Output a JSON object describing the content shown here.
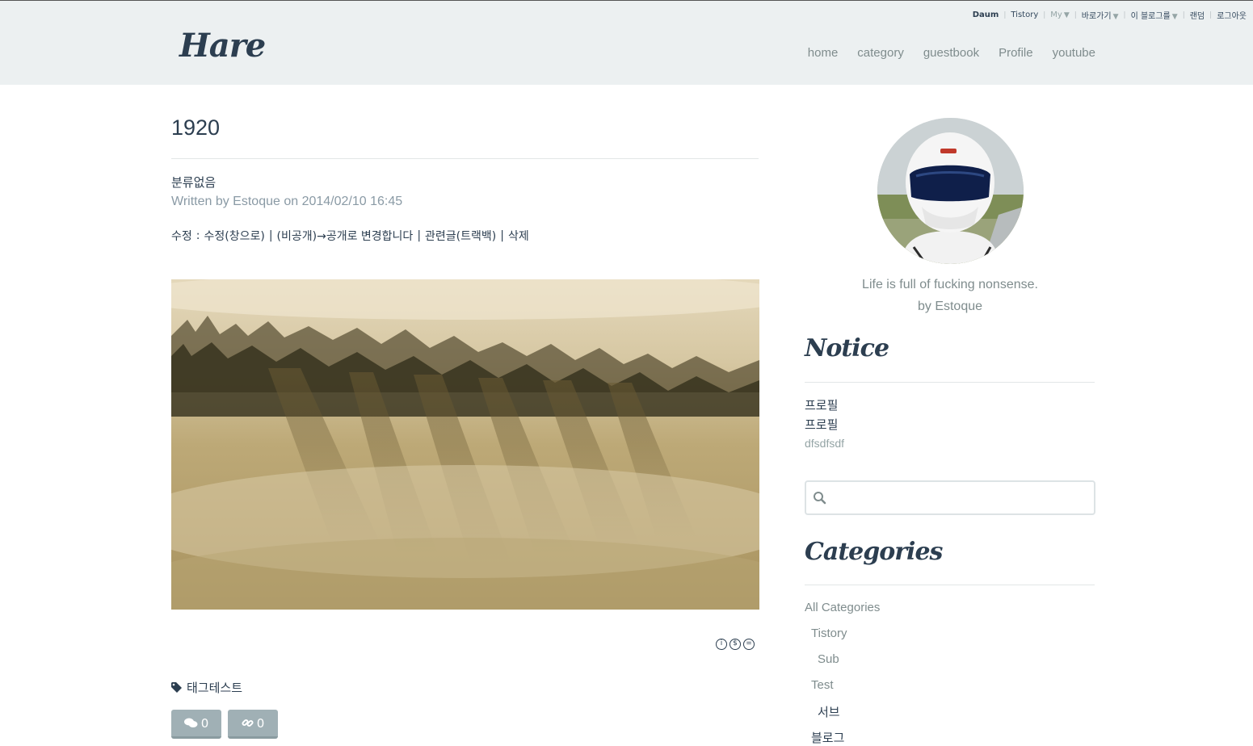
{
  "topbar": {
    "items": [
      {
        "label": "Daum",
        "dropdown": false
      },
      {
        "label": "Tistory",
        "dropdown": false
      },
      {
        "label": "My",
        "dropdown": true
      },
      {
        "label": "바로가기",
        "dropdown": true
      },
      {
        "label": "이 블로그를",
        "dropdown": true
      },
      {
        "label": "랜덤",
        "dropdown": false
      },
      {
        "label": "로그아웃",
        "dropdown": false
      }
    ],
    "arrow": "▼"
  },
  "header": {
    "logo": "Hare",
    "nav": [
      "home",
      "category",
      "guestbook",
      "Profile",
      "youtube"
    ]
  },
  "post": {
    "title": "1920",
    "category": "분류없음",
    "meta": "Written by Estoque on 2014/02/10 16:45",
    "admin": {
      "edit_label": "수정",
      "colon": ":",
      "edit_window": "수정(창으로)",
      "visibility": "(비공개)→공개로 변경합니다",
      "trackback": "관련글(트랙백)",
      "delete": "삭제",
      "sep": "|"
    },
    "tag": "태그테스트",
    "comment_count": "0",
    "trackback_count": "0"
  },
  "sidebar": {
    "tagline_line1": "Life is full of fucking nonsense.",
    "tagline_line2": "by Estoque",
    "notice_title": "Notice",
    "notices": [
      "프로필",
      "프로필",
      "dfsdfsdf"
    ],
    "search_placeholder": "",
    "categories_title": "Categories",
    "categories": [
      {
        "label": "All Categories",
        "level": 0
      },
      {
        "label": "Tistory",
        "level": 1
      },
      {
        "label": "Sub",
        "level": 2
      },
      {
        "label": "Test",
        "level": 1
      },
      {
        "label": "서브",
        "level": 2
      },
      {
        "label": "블로그",
        "level": 1
      }
    ]
  },
  "colors": {
    "header_bg": "#ecf0f1",
    "primary_text": "#2c3e50",
    "muted_text": "#7f8c8d",
    "button_bg": "#a0b0b5"
  }
}
